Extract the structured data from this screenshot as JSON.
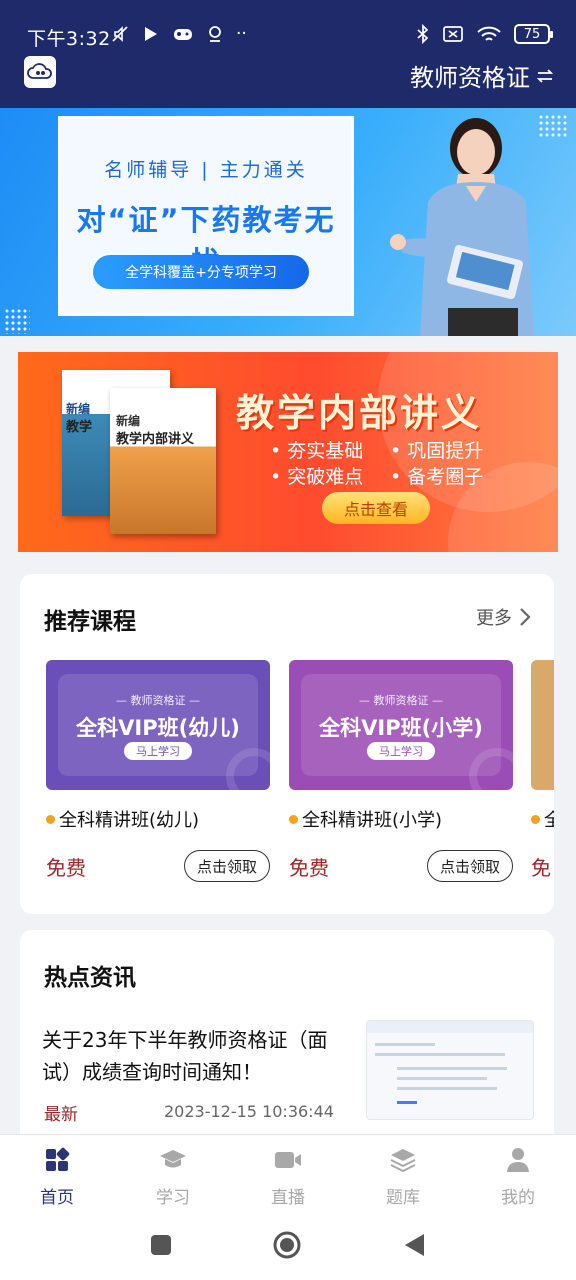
{
  "status": {
    "time": "下午3:32",
    "battery": "75",
    "left_icons": [
      "mute-icon",
      "play-icon",
      "gamepad-icon",
      "location-icon",
      "more-dots-icon"
    ],
    "right_icons": [
      "bluetooth-icon",
      "sim-off-icon",
      "wifi-icon",
      "battery-icon"
    ]
  },
  "header": {
    "title": "教师资格证",
    "switch_icon": "swap-icon"
  },
  "hero": {
    "line1": "名师辅导 | 主力通关",
    "line2": "对“证”下药教考无忧",
    "pill": "全学科覆盖+分专项学习"
  },
  "promo": {
    "title": "教学内部讲义",
    "bullets": [
      "• 夯实基础",
      "• 巩固提升",
      "• 突破难点",
      "• 备考圈子"
    ],
    "cta": "点击查看",
    "book_a_line1": "新编",
    "book_a_line2": "教学",
    "book_b_line1": "新编",
    "book_b_line2": "教学内部讲义"
  },
  "recommend": {
    "title": "推荐课程",
    "more": "更多",
    "courses": [
      {
        "cert": "— 教师资格证 —",
        "banner": "全科VIP班(幼儿)",
        "btn": "马上学习",
        "name": "全科精讲班(幼儿)",
        "price": "免费",
        "claim": "点击领取",
        "color": "#6a4fb8"
      },
      {
        "cert": "— 教师资格证 —",
        "banner": "全科VIP班(小学)",
        "btn": "马上学习",
        "name": "全科精讲班(小学)",
        "price": "免费",
        "claim": "点击领取",
        "color": "#9a4db4"
      },
      {
        "name": "全",
        "price": "免",
        "color": "#d8a96a"
      }
    ]
  },
  "news": {
    "title": "热点资讯",
    "item": {
      "headline": "关于23年下半年教师资格证（面试）成绩查询时间通知！",
      "tag": "最新",
      "time": "2023-12-15 10:36:44"
    }
  },
  "tabs": [
    {
      "label": "首页",
      "icon": "home-grid-icon",
      "active": true
    },
    {
      "label": "学习",
      "icon": "graduation-cap-icon",
      "active": false
    },
    {
      "label": "直播",
      "icon": "video-camera-icon",
      "active": false
    },
    {
      "label": "题库",
      "icon": "layers-icon",
      "active": false
    },
    {
      "label": "我的",
      "icon": "user-icon",
      "active": false
    }
  ],
  "colors": {
    "header_bg": "#1f2a6b",
    "accent": "#2b3576",
    "price": "#9c2727",
    "dot": "#f4a11c"
  }
}
